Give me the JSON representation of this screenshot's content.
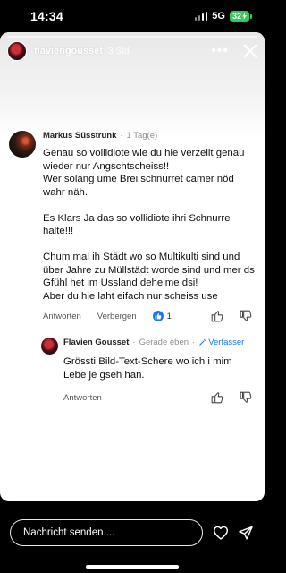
{
  "status_bar": {
    "time": "14:34",
    "network": "5G",
    "battery": "32"
  },
  "story": {
    "username": "flaviengousset",
    "age": "3 Std."
  },
  "comment": {
    "author": "Markus Süsstrunk",
    "time": "1 Tag(e)",
    "text": "Genau so vollidiote wie du hie verzellt genau wieder nur Angschtscheiss!!\nWer solang ume Brei schnurret camer nöd wahr näh.\n\nEs Klars Ja das so vollidiote ihri Schnurre halte!!!\n\nChum mal ih Städt wo so Multikulti sind und über Jahre zu Müllstädt worde sind und mer ds Gfühl het im Ussland deheime dsi!\nAber du hie laht eifach nur scheiss use",
    "reply_label": "Antworten",
    "translate_label": "Verbergen",
    "like_count": "1"
  },
  "reply": {
    "author": "Flavien Gousset",
    "time": "Gerade eben",
    "author_tag": "Verfasser",
    "text": "Grössti Bild-Text-Schere wo ich i mim Lebe je gseh han.",
    "reply_label": "Antworten"
  },
  "bottom": {
    "message_placeholder": "Nachricht senden ..."
  },
  "icons": {
    "like": "thumbs-up-icon",
    "dislike": "thumbs-down-icon",
    "heart": "heart-icon",
    "send": "send-icon",
    "more": "more-icon",
    "close": "close-icon",
    "author": "pencil-icon"
  },
  "colors": {
    "accent": "#1877f2",
    "battery": "#34c759"
  }
}
